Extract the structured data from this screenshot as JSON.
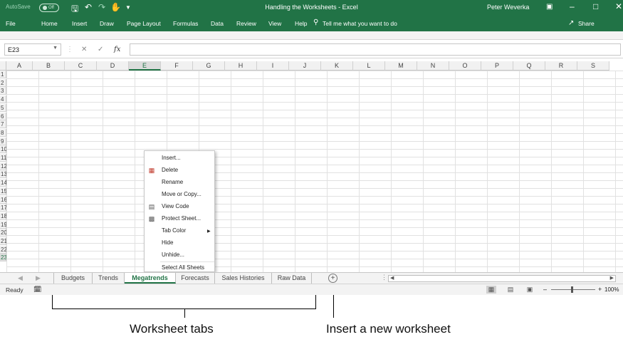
{
  "titlebar": {
    "autosave": "AutoSave",
    "toggle": "Off",
    "title": "Handling the Worksheets - Excel",
    "user": "Peter Weverka",
    "save_icon": "save-icon",
    "undo_icon": "undo-icon",
    "redo_icon": "redo-icon"
  },
  "ribbon": {
    "tabs": [
      "File",
      "Home",
      "Insert",
      "Draw",
      "Page Layout",
      "Formulas",
      "Data",
      "Review",
      "View",
      "Help"
    ],
    "tellme": "Tell me what you want to do",
    "share": "Share"
  },
  "formula_bar": {
    "name_box": "E23",
    "fx": "fx",
    "value": ""
  },
  "columns": [
    "A",
    "B",
    "C",
    "D",
    "E",
    "F",
    "G",
    "H",
    "I",
    "J",
    "K",
    "L",
    "M",
    "N",
    "O",
    "P",
    "Q",
    "R",
    "S"
  ],
  "selected_column": "E",
  "rows": [
    "1",
    "2",
    "3",
    "4",
    "5",
    "6",
    "7",
    "8",
    "9",
    "10",
    "11",
    "12",
    "13",
    "14",
    "15",
    "16",
    "17",
    "18",
    "19",
    "20",
    "21",
    "22",
    "23"
  ],
  "selected_row": "23",
  "context_menu": {
    "items": [
      {
        "label": "Insert...",
        "icon": ""
      },
      {
        "label": "Delete",
        "icon": "delete-icon"
      },
      {
        "label": "Rename",
        "icon": ""
      },
      {
        "label": "Move or Copy...",
        "icon": ""
      },
      {
        "label": "View Code",
        "icon": "view-code-icon"
      },
      {
        "label": "Protect Sheet...",
        "icon": "protect-sheet-icon"
      },
      {
        "label": "Tab Color",
        "icon": ""
      },
      {
        "label": "Hide",
        "icon": ""
      },
      {
        "label": "Unhide...",
        "icon": ""
      },
      {
        "label": "Select All Sheets",
        "icon": ""
      }
    ]
  },
  "sheet_tabs": [
    "Budgets",
    "Trends",
    "Megatrends",
    "Forecasts",
    "Sales Histories",
    "Raw Data"
  ],
  "active_sheet": "Megatrends",
  "status": {
    "ready": "Ready",
    "zoom": "100%"
  },
  "annotations": {
    "worksheet_tabs": "Worksheet tabs",
    "insert_new": "Insert a new worksheet"
  }
}
